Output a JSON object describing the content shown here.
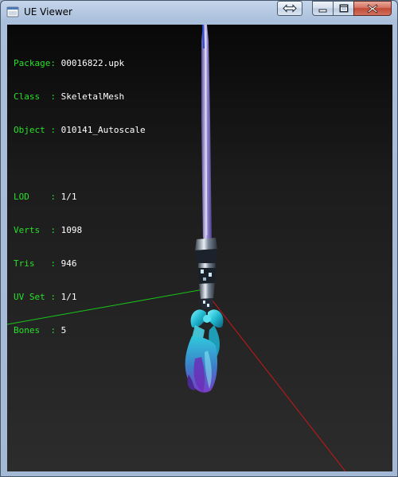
{
  "window": {
    "title": "UE Viewer",
    "icon": "ue-viewer-app-icon"
  },
  "caption_buttons": {
    "extra_icon": "double-arrow-icon",
    "minimize_icon": "minimize-icon",
    "maximize_icon": "maximize-icon",
    "close_icon": "close-icon"
  },
  "info": {
    "package_label": "Package",
    "package_value": "00016822.upk",
    "class_label": "Class",
    "class_value": "SkeletalMesh",
    "object_label": "Object",
    "object_value": "010141_Autoscale",
    "lod_label": "LOD",
    "lod_value": "1/1",
    "verts_label": "Verts",
    "verts_value": "1098",
    "tris_label": "Tris",
    "tris_value": "946",
    "uvset_label": "UV Set",
    "uvset_value": "1/1",
    "bones_label": "Bones",
    "bones_value": "5"
  },
  "colors": {
    "label_green": "#28e028",
    "value_white": "#ffffff",
    "axis_x": "#c81818",
    "axis_y": "#18c818",
    "axis_z": "#1818c8",
    "mesh_ribbon": "#2fd0e0",
    "mesh_blade": "#8c7ad0"
  }
}
